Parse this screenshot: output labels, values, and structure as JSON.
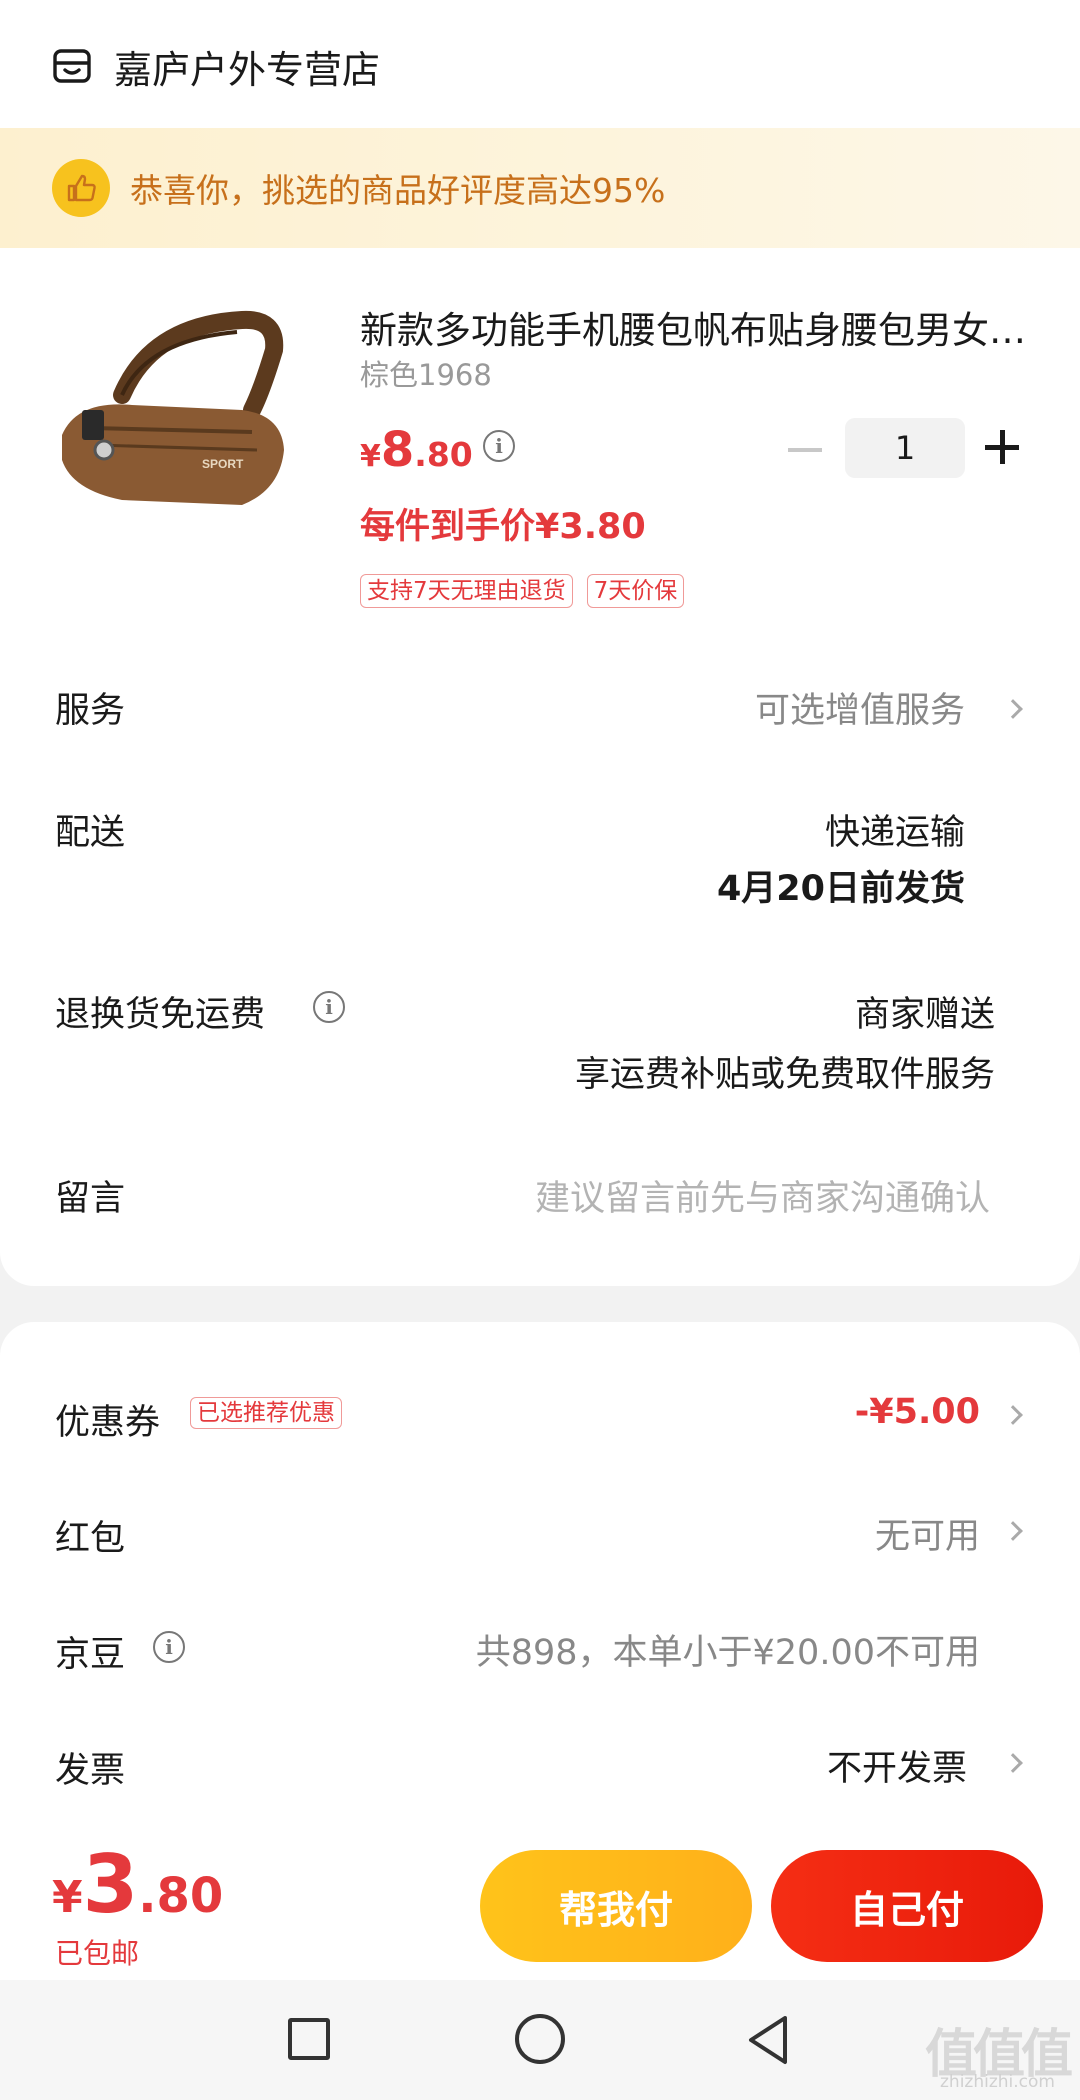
{
  "store": {
    "name": "嘉庐户外专营店",
    "icon": "store-icon"
  },
  "praise_banner": {
    "icon": "thumbs-up-icon",
    "text": "恭喜你，挑选的商品好评度高达95%"
  },
  "product": {
    "title": "新款多功能手机腰包帆布贴身腰包男女户外运动跑步腰包",
    "spec": "棕色1968",
    "price": {
      "currency": "¥",
      "integer": "8",
      "decimal": ".80"
    },
    "final_price": "每件到手价¥3.80",
    "quantity": "1",
    "tags": [
      "支持7天无理由退货",
      "7天价保"
    ],
    "image_print": "SPORT"
  },
  "rows": {
    "service": {
      "label": "服务",
      "value": "可选增值服务"
    },
    "delivery": {
      "label": "配送",
      "value1": "快递运输",
      "value2": "4月20日前发货"
    },
    "return_freight": {
      "label": "退换货免运费",
      "value1": "商家赠送",
      "value2": "享运费补贴或免费取件服务"
    },
    "message": {
      "label": "留言",
      "placeholder": "建议留言前先与商家沟通确认"
    }
  },
  "discounts": {
    "coupon": {
      "label": "优惠券",
      "tag": "已选推荐优惠",
      "value": "-¥5.00"
    },
    "red_packet": {
      "label": "红包",
      "value": "无可用"
    },
    "jingdou": {
      "label": "京豆",
      "value": "共898，本单小于¥20.00不可用"
    },
    "invoice": {
      "label": "发票",
      "value": "不开发票"
    }
  },
  "footer": {
    "total": {
      "currency": "¥",
      "integer": "3",
      "decimal": ".80"
    },
    "shipping": "已包邮",
    "help_pay": "帮我付",
    "self_pay": "自己付"
  },
  "watermark": {
    "main": "值值值",
    "sub": "zhizhizhi.com"
  },
  "colors": {
    "accent_red": "#e4393c",
    "help_button": "#ffbb1a",
    "self_button": "#f02a12",
    "banner_text": "#c7701b"
  }
}
